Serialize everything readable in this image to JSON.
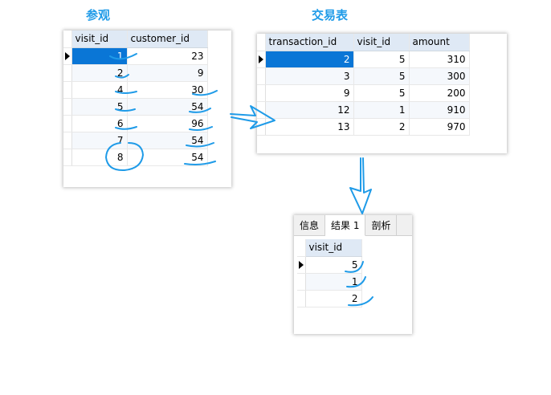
{
  "headings": {
    "left": "参观",
    "right": "交易表"
  },
  "visits_table": {
    "columns": [
      "visit_id",
      "customer_id"
    ],
    "rows": [
      {
        "visit_id": "1",
        "customer_id": "23"
      },
      {
        "visit_id": "2",
        "customer_id": "9"
      },
      {
        "visit_id": "4",
        "customer_id": "30"
      },
      {
        "visit_id": "5",
        "customer_id": "54"
      },
      {
        "visit_id": "6",
        "customer_id": "96"
      },
      {
        "visit_id": "7",
        "customer_id": "54"
      },
      {
        "visit_id": "8",
        "customer_id": "54"
      }
    ],
    "selected_row": 0
  },
  "transactions_table": {
    "columns": [
      "transaction_id",
      "visit_id",
      "amount"
    ],
    "rows": [
      {
        "transaction_id": "2",
        "visit_id": "5",
        "amount": "310"
      },
      {
        "transaction_id": "3",
        "visit_id": "5",
        "amount": "300"
      },
      {
        "transaction_id": "9",
        "visit_id": "5",
        "amount": "200"
      },
      {
        "transaction_id": "12",
        "visit_id": "1",
        "amount": "910"
      },
      {
        "transaction_id": "13",
        "visit_id": "2",
        "amount": "970"
      }
    ],
    "selected_row": 0
  },
  "result_panel": {
    "tabs": [
      "信息",
      "结果 1",
      "剖析"
    ],
    "active_tab": 1,
    "columns": [
      "visit_id"
    ],
    "rows": [
      {
        "visit_id": "5"
      },
      {
        "visit_id": "1"
      },
      {
        "visit_id": "2"
      }
    ]
  },
  "colors": {
    "accent": "#1f9be8",
    "selection": "#0a76d6",
    "header_bg": "#dfe9f5"
  }
}
